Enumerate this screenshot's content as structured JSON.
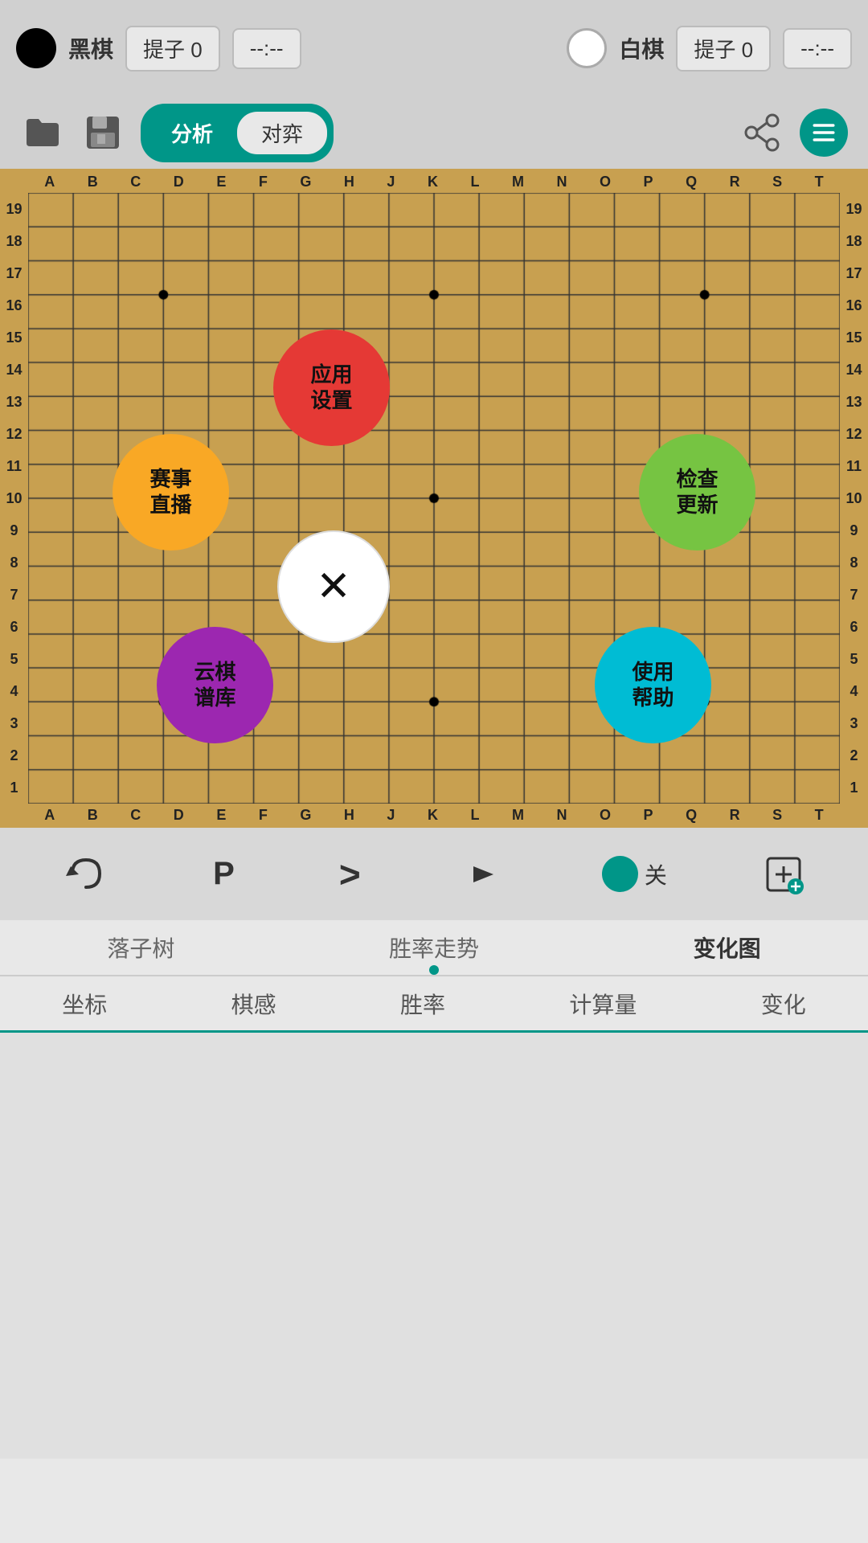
{
  "header": {
    "black_label": "黑棋",
    "white_label": "白棋",
    "black_capture_label": "提子",
    "white_capture_label": "提子",
    "black_capture_count": "0",
    "white_capture_count": "0",
    "black_time": "--:--",
    "white_time": "--:--"
  },
  "toolbar": {
    "mode_analyze": "分析",
    "mode_battle": "对弈"
  },
  "board": {
    "col_labels": [
      "A",
      "B",
      "C",
      "D",
      "E",
      "F",
      "G",
      "H",
      "J",
      "K",
      "L",
      "M",
      "N",
      "O",
      "P",
      "Q",
      "R",
      "S",
      "T"
    ],
    "row_labels": [
      "19",
      "18",
      "17",
      "16",
      "15",
      "14",
      "13",
      "12",
      "11",
      "10",
      "9",
      "8",
      "7",
      "6",
      "5",
      "4",
      "3",
      "2",
      "1"
    ],
    "star_points": [
      [
        3,
        3
      ],
      [
        9,
        3
      ],
      [
        15,
        3
      ],
      [
        3,
        9
      ],
      [
        9,
        9
      ],
      [
        15,
        9
      ],
      [
        3,
        15
      ],
      [
        9,
        15
      ],
      [
        15,
        15
      ]
    ]
  },
  "menu_items": {
    "settings": "应用\n设置",
    "broadcast": "赛事\n直播",
    "close": "×",
    "check_update": "检查\n更新",
    "cloud_library": "云棋\n谱库",
    "help": "使用\n帮助"
  },
  "bottom_toolbar": {
    "undo_label": "",
    "pass_label": "P",
    "forward_label": ">",
    "toggle_label": "关",
    "add_label": ""
  },
  "tabs": {
    "items": [
      "落子树",
      "胜率走势",
      "变化图"
    ],
    "active_index": 2
  },
  "subtabs": {
    "items": [
      "坐标",
      "棋感",
      "胜率",
      "计算量",
      "变化"
    ]
  },
  "colors": {
    "teal": "#009688",
    "board_bg": "#c8a050",
    "settings_red": "#e53935",
    "broadcast_orange": "#f9a825",
    "check_update_green": "#76c442",
    "cloud_purple": "#9c27b0",
    "help_blue": "#00bcd4",
    "close_white": "#ffffff"
  }
}
